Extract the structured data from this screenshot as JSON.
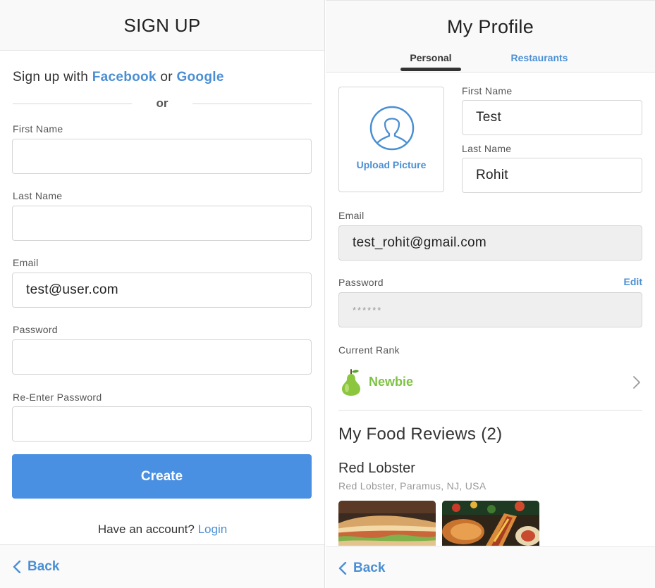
{
  "signup": {
    "title": "SIGN UP",
    "social_prefix": "Sign up with ",
    "facebook_label": "Facebook",
    "social_or": " or ",
    "google_label": "Google",
    "divider_text": "or",
    "fields": {
      "first_name": {
        "label": "First Name",
        "value": ""
      },
      "last_name": {
        "label": "Last Name",
        "value": ""
      },
      "email": {
        "label": "Email",
        "value": "test@user.com"
      },
      "password": {
        "label": "Password",
        "value": ""
      },
      "reenter_password": {
        "label": "Re-Enter Password",
        "value": ""
      }
    },
    "create_label": "Create",
    "account_prompt": "Have an account? ",
    "login_label": "Login",
    "back_label": "Back"
  },
  "profile": {
    "title": "My Profile",
    "tabs": [
      {
        "label": "Personal",
        "active": true
      },
      {
        "label": "Restaurants",
        "active": false
      }
    ],
    "upload_label": "Upload Picture",
    "first_name": {
      "label": "First Name",
      "value": "Test"
    },
    "last_name": {
      "label": "Last Name",
      "value": "Rohit"
    },
    "email": {
      "label": "Email",
      "value": "test_rohit@gmail.com"
    },
    "password": {
      "label": "Password",
      "value": "******",
      "edit_label": "Edit"
    },
    "rank": {
      "label": "Current Rank",
      "value": "Newbie",
      "icon": "pear-icon",
      "color": "#7dc242"
    },
    "reviews_heading": "My Food Reviews (2)",
    "review": {
      "restaurant": "Red Lobster",
      "location": "Red Lobster, Paramus, NJ, USA"
    },
    "back_label": "Back"
  },
  "colors": {
    "accent": "#4a8fd4",
    "button": "#4a90e2",
    "rank_green": "#7dc242"
  }
}
